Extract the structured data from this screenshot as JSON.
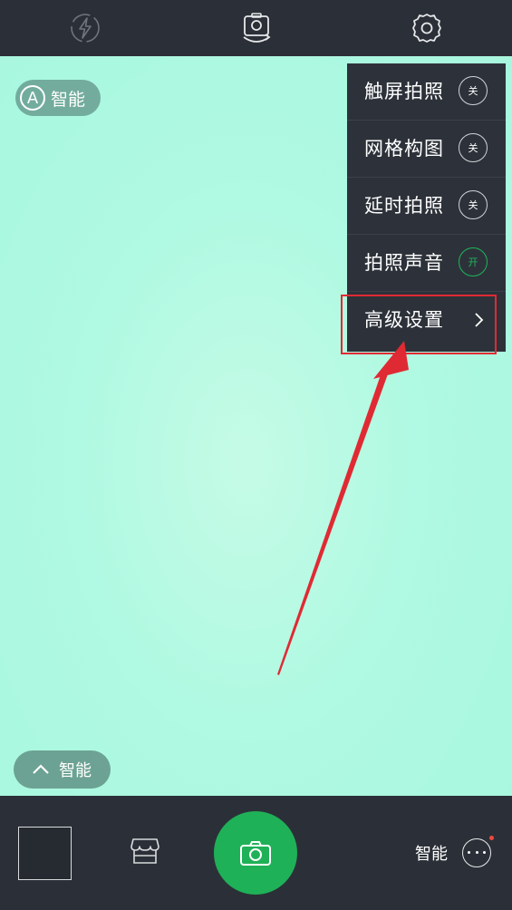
{
  "topbar": {
    "icons": [
      "flash-auto-icon",
      "switch-camera-icon",
      "gear-icon"
    ]
  },
  "viewfinder": {
    "mode_badge_letter": "A",
    "mode_badge_label": "智能"
  },
  "settings_menu": {
    "items": [
      {
        "label": "触屏拍照",
        "toggle": "关",
        "state": "off"
      },
      {
        "label": "网格构图",
        "toggle": "关",
        "state": "off"
      },
      {
        "label": "延时拍照",
        "toggle": "关",
        "state": "off"
      },
      {
        "label": "拍照声音",
        "toggle": "开",
        "state": "on"
      },
      {
        "label": "高级设置",
        "icon": "chevron-right-icon"
      }
    ]
  },
  "annotation": {
    "highlight_color": "#e02a33",
    "target": "高级设置"
  },
  "mode_selector": {
    "label": "智能",
    "icon": "chevron-up-icon"
  },
  "bottombar": {
    "mode_label": "智能",
    "shutter_color": "#1fb157",
    "icons": [
      "gallery-thumbnail",
      "store-icon",
      "camera-icon",
      "more-icon"
    ]
  }
}
